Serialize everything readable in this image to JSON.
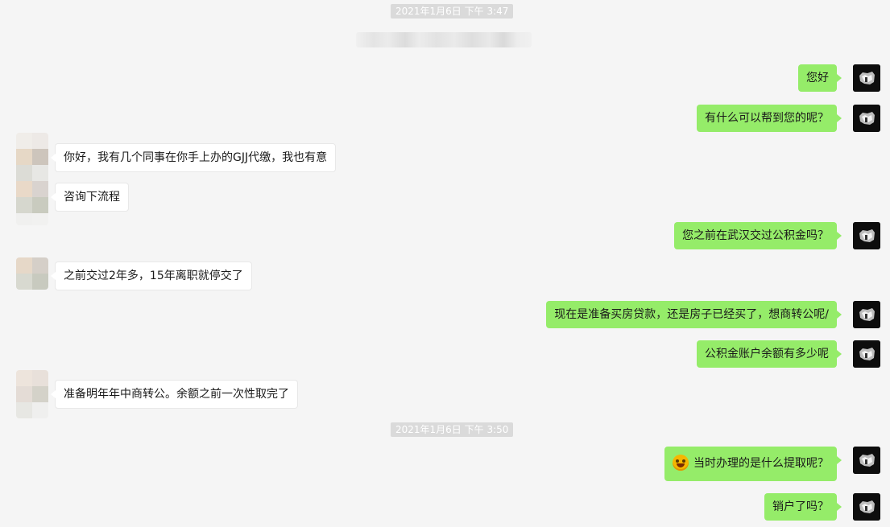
{
  "chat": {
    "timestamps": [
      "2021年1月6日 下午 3:47",
      "2021年1月6日 下午 3:50"
    ],
    "messages": [
      {
        "side": "out",
        "text": "您好"
      },
      {
        "side": "out",
        "text": "有什么可以帮到您的呢？"
      },
      {
        "side": "in",
        "text": "你好，我有几个同事在你手上办的GJJ代缴，我也有意"
      },
      {
        "side": "in",
        "text": "咨询下流程"
      },
      {
        "side": "out",
        "text": "您之前在武汉交过公积金吗？"
      },
      {
        "side": "in",
        "text": "之前交过2年多，15年离职就停交了"
      },
      {
        "side": "out",
        "text": "现在是准备买房贷款，还是房子已经买了，想商转公呢/"
      },
      {
        "side": "out",
        "text": "公积金账户余额有多少呢"
      },
      {
        "side": "in",
        "text": "准备明年年中商转公。余额之前一次性取完了"
      },
      {
        "side": "out",
        "text": "当时办理的是什么提取呢？",
        "emoji": "laughing-tears-emoji"
      },
      {
        "side": "out",
        "text": "销户了吗？"
      }
    ]
  },
  "colors": {
    "background": "#f5f5f5",
    "outgoing_bubble": "#95ec69",
    "incoming_bubble": "#ffffff",
    "timestamp_bg": "#dadada"
  }
}
